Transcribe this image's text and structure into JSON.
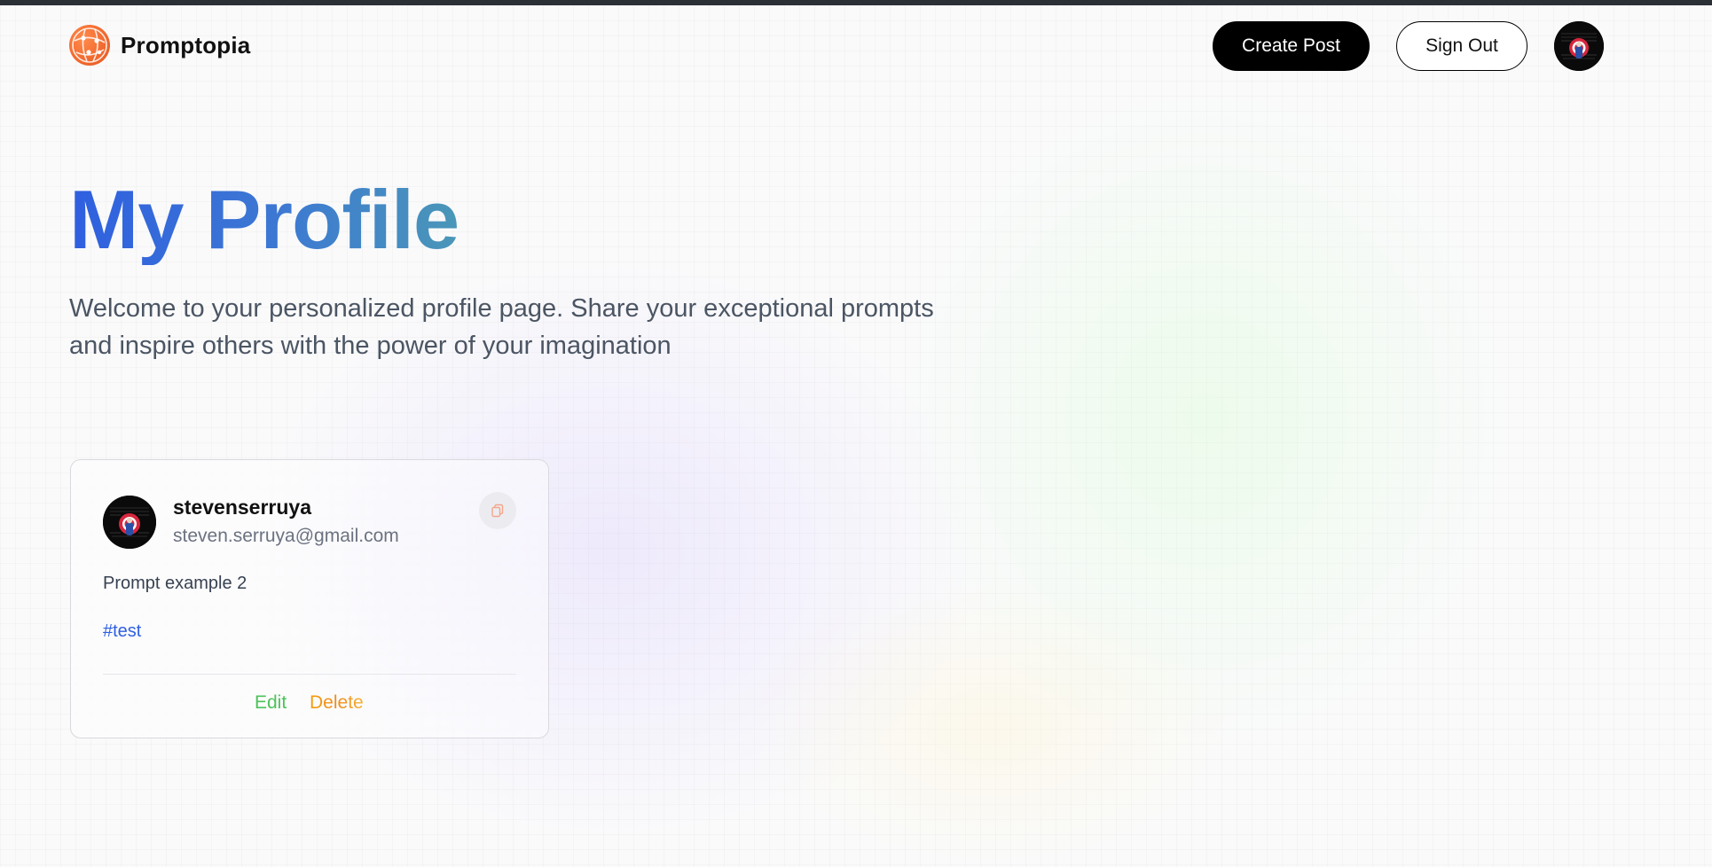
{
  "nav": {
    "brand_name": "Promptopia",
    "logo_icon": "globe-network-icon",
    "create_post_label": "Create Post",
    "sign_out_label": "Sign Out",
    "avatar_icon": "user-avatar"
  },
  "header": {
    "title": "My Profile",
    "description": "Welcome to your personalized profile page. Share your exceptional prompts and inspire others with the power of your imagination"
  },
  "prompts": [
    {
      "username": "stevenserruya",
      "email": "steven.serruya@gmail.com",
      "prompt": "Prompt example 2",
      "tag": "#test",
      "edit_label": "Edit",
      "delete_label": "Delete",
      "copy_icon": "copy-icon"
    }
  ],
  "colors": {
    "accent_blue": "#2f5fe0",
    "brand_orange": "#f26b30",
    "edit_green": "#4ec25a",
    "delete_orange": "#f59e0b"
  }
}
